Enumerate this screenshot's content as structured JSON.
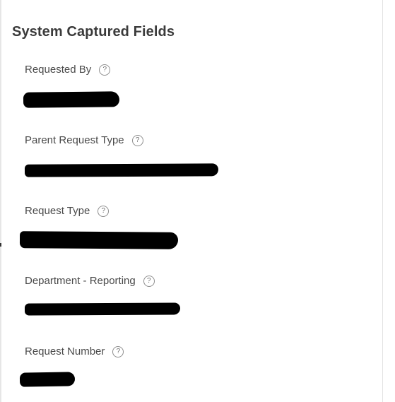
{
  "section": {
    "title": "System Captured Fields"
  },
  "fields": [
    {
      "label": "Requested By",
      "help_icon": "question-circle-icon"
    },
    {
      "label": "Parent Request Type",
      "help_icon": "question-circle-icon"
    },
    {
      "label": "Request Type",
      "help_icon": "question-circle-icon"
    },
    {
      "label": "Department - Reporting",
      "help_icon": "question-circle-icon"
    },
    {
      "label": "Request Number",
      "help_icon": "question-circle-icon"
    }
  ],
  "help_glyph": "?",
  "colors": {
    "background": "#ffffff",
    "title": "#3b3b3b",
    "label": "#4a4a4a",
    "redaction": "#000000"
  }
}
